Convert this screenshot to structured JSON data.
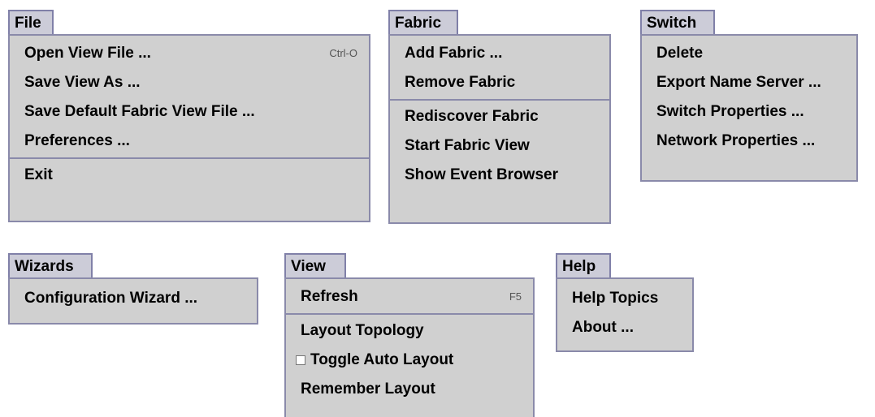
{
  "file": {
    "title": "File",
    "items": [
      {
        "label": "Open View File ...",
        "shortcut": "Ctrl-O"
      },
      {
        "label": "Save View As ..."
      },
      {
        "label": "Save Default Fabric View File ..."
      },
      {
        "label": "Preferences ..."
      },
      {
        "label": "Exit"
      }
    ]
  },
  "fabric": {
    "title": "Fabric",
    "items": [
      {
        "label": "Add Fabric ..."
      },
      {
        "label": "Remove Fabric"
      },
      {
        "label": "Rediscover Fabric"
      },
      {
        "label": "Start Fabric View"
      },
      {
        "label": "Show Event Browser"
      }
    ]
  },
  "switch": {
    "title": "Switch",
    "items": [
      {
        "label": "Delete"
      },
      {
        "label": "Export Name Server ..."
      },
      {
        "label": "Switch Properties ..."
      },
      {
        "label": "Network Properties ..."
      }
    ]
  },
  "wizards": {
    "title": "Wizards",
    "items": [
      {
        "label": "Configuration Wizard ..."
      }
    ]
  },
  "view": {
    "title": "View",
    "items": [
      {
        "label": "Refresh",
        "shortcut": "F5"
      },
      {
        "label": "Layout Topology"
      },
      {
        "label": "Toggle Auto Layout"
      },
      {
        "label": "Remember Layout"
      }
    ]
  },
  "help": {
    "title": "Help",
    "items": [
      {
        "label": "Help Topics"
      },
      {
        "label": "About ..."
      }
    ]
  }
}
